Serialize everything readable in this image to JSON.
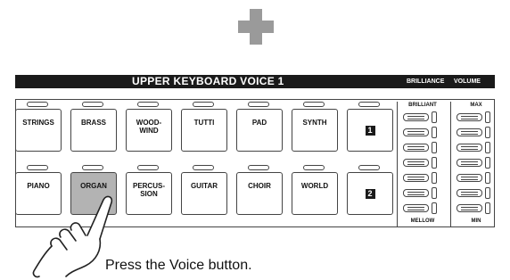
{
  "panel": {
    "title": "UPPER KEYBOARD VOICE 1",
    "brilliance_header": "BRILLIANCE",
    "volume_header": "VOLUME",
    "brilliance_top": "BRILLIANT",
    "brilliance_bottom": "MELLOW",
    "volume_top": "MAX",
    "volume_bottom": "MIN"
  },
  "voices": {
    "row1": [
      "STRINGS",
      "BRASS",
      "WOOD-\nWIND",
      "TUTTI",
      "PAD",
      "SYNTH",
      "1"
    ],
    "row2": [
      "PIANO",
      "ORGAN",
      "PERCUS-\nSION",
      "GUITAR",
      "CHOIR",
      "WORLD",
      "2"
    ],
    "pressed": "ORGAN"
  },
  "instruction": "Press the Voice button.",
  "icons": {
    "plus": "plus-icon",
    "hand": "pointing-hand-icon"
  },
  "colors": {
    "header_bg": "#1a1a1a",
    "plus": "#9a9a9a",
    "pressed_button": "#b3b3b3"
  }
}
